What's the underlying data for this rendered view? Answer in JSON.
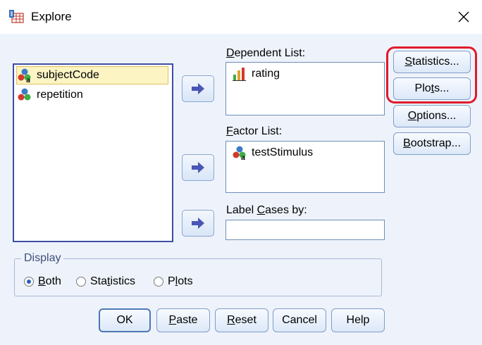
{
  "window": {
    "title": "Explore"
  },
  "source_list": {
    "items": [
      {
        "label": "subjectCode",
        "icon": "nominal-variable-icon",
        "selected": true
      },
      {
        "label": "repetition",
        "icon": "nominal-variable-icon",
        "selected": false
      }
    ]
  },
  "dependent_list": {
    "label_prefix": "",
    "label_mnemonic": "D",
    "label_rest": "ependent List:",
    "items": [
      {
        "label": "rating",
        "icon": "scale-variable-icon"
      }
    ]
  },
  "factor_list": {
    "label_mnemonic": "F",
    "label_rest": "actor List:",
    "items": [
      {
        "label": "testStimulus",
        "icon": "nominal-variable-icon"
      }
    ]
  },
  "label_cases": {
    "label_pre": "Label ",
    "label_mnemonic": "C",
    "label_post": "ases by:",
    "value": ""
  },
  "side_buttons": {
    "statistics": {
      "mn": "S",
      "rest": "tatistics..."
    },
    "plots": {
      "pre": "Plo",
      "mn": "t",
      "rest": "s..."
    },
    "options": {
      "mn": "O",
      "rest": "ptions..."
    },
    "bootstrap": {
      "mn": "B",
      "rest": "ootstrap..."
    }
  },
  "display": {
    "title": "Display",
    "both": {
      "mn": "B",
      "rest": "oth",
      "checked": true
    },
    "statistics": {
      "pre": "Sta",
      "mn": "t",
      "rest": "istics",
      "checked": false
    },
    "plots": {
      "pre": "P",
      "mn": "l",
      "rest": "ots",
      "checked": false
    }
  },
  "footer": {
    "ok": "OK",
    "paste": {
      "mn": "P",
      "rest": "aste"
    },
    "reset": {
      "mn": "R",
      "rest": "eset"
    },
    "cancel": "Cancel",
    "help": "Help"
  },
  "colors": {
    "highlight": "#e11a2b",
    "accent": "#2b62b8",
    "arrow": "#4a56b5"
  }
}
